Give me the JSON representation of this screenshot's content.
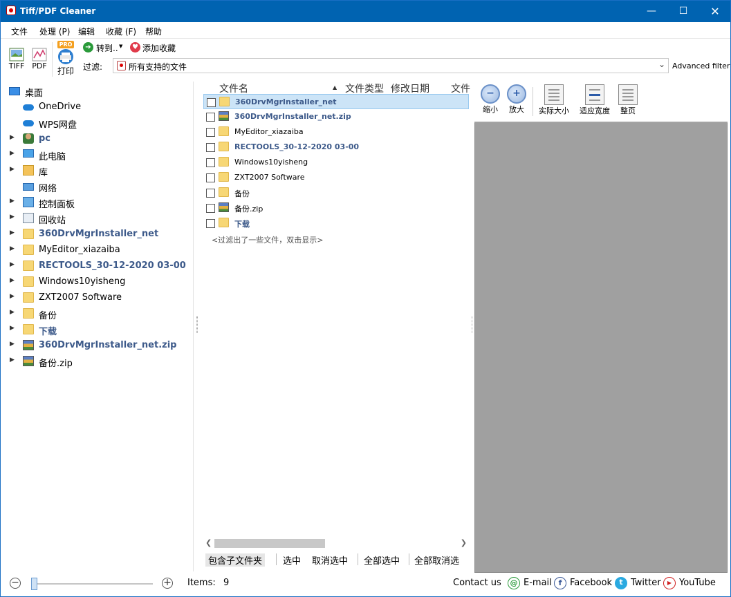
{
  "window": {
    "title": "Tiff/PDF Cleaner"
  },
  "menu": [
    "文件",
    "处理 (P)",
    "编辑",
    "收藏 (F)",
    "帮助"
  ],
  "toolbar": {
    "tiff_label": "TIFF",
    "pdf_label": "PDF",
    "pro_badge": "PRO",
    "print_label": "打印",
    "goto_label": "转到..",
    "add_fav_label": "添加收藏",
    "filter_label": "过滤:",
    "filter_value": "所有支持的文件",
    "advanced_filter": "Advanced filter"
  },
  "tree": [
    {
      "label": "桌面",
      "icon": "desktop-icon",
      "expand": false,
      "highlight": false
    },
    {
      "label": "OneDrive",
      "icon": "cloud-icon",
      "expand": false,
      "highlight": false
    },
    {
      "label": "WPS网盘",
      "icon": "cloud-icon",
      "expand": false,
      "highlight": false
    },
    {
      "label": "pc",
      "icon": "user-icon",
      "expand": true,
      "highlight": true
    },
    {
      "label": "此电脑",
      "icon": "computer-icon",
      "expand": true,
      "highlight": false
    },
    {
      "label": "库",
      "icon": "library-icon",
      "expand": true,
      "highlight": false
    },
    {
      "label": "网络",
      "icon": "network-icon",
      "expand": false,
      "highlight": false
    },
    {
      "label": "控制面板",
      "icon": "control-panel-icon",
      "expand": true,
      "highlight": false
    },
    {
      "label": "回收站",
      "icon": "recycle-bin-icon",
      "expand": true,
      "highlight": false
    },
    {
      "label": "360DrvMgrInstaller_net",
      "icon": "folder-icon",
      "expand": true,
      "highlight": true
    },
    {
      "label": "MyEditor_xiazaiba",
      "icon": "folder-icon",
      "expand": true,
      "highlight": false
    },
    {
      "label": "RECTOOLS_30-12-2020 03-00",
      "icon": "folder-icon",
      "expand": true,
      "highlight": true
    },
    {
      "label": "Windows10yisheng",
      "icon": "folder-icon",
      "expand": true,
      "highlight": false
    },
    {
      "label": "ZXT2007 Software",
      "icon": "folder-icon",
      "expand": true,
      "highlight": false
    },
    {
      "label": "备份",
      "icon": "folder-icon",
      "expand": true,
      "highlight": false
    },
    {
      "label": "下载",
      "icon": "folder-icon",
      "expand": true,
      "highlight": true
    },
    {
      "label": "360DrvMgrInstaller_net.zip",
      "icon": "zip-icon",
      "expand": true,
      "highlight": true
    },
    {
      "label": "备份.zip",
      "icon": "zip-icon",
      "expand": true,
      "highlight": false
    }
  ],
  "file_list": {
    "columns": [
      "文件名",
      "文件类型",
      "修改日期",
      "文件"
    ],
    "rows": [
      {
        "name": "360DrvMgrInstaller_net",
        "icon": "folder-icon",
        "highlight": true,
        "selected": true
      },
      {
        "name": "360DrvMgrInstaller_net.zip",
        "icon": "zip-icon",
        "highlight": true,
        "selected": false
      },
      {
        "name": "MyEditor_xiazaiba",
        "icon": "folder-icon",
        "highlight": false,
        "selected": false
      },
      {
        "name": "RECTOOLS_30-12-2020 03-00",
        "icon": "folder-icon",
        "highlight": true,
        "selected": false
      },
      {
        "name": "Windows10yisheng",
        "icon": "folder-icon",
        "highlight": false,
        "selected": false
      },
      {
        "name": "ZXT2007 Software",
        "icon": "folder-icon",
        "highlight": false,
        "selected": false
      },
      {
        "name": "备份",
        "icon": "folder-icon",
        "highlight": false,
        "selected": false
      },
      {
        "name": "备份.zip",
        "icon": "zip-icon",
        "highlight": false,
        "selected": false
      },
      {
        "name": "下载",
        "icon": "folder-icon",
        "highlight": true,
        "selected": false
      }
    ],
    "hint": "<过滤出了一些文件，双击显示>"
  },
  "list_actions": [
    "包含子文件夹",
    "选中",
    "取消选中",
    "全部选中",
    "全部取消选"
  ],
  "viewer": {
    "zoom_out": "缩小",
    "zoom_in": "放大",
    "actual_size": "实际大小",
    "fit_width": "适应宽度",
    "full_page": "整页"
  },
  "status": {
    "items_label": "Items:",
    "items_count": "9",
    "contact": "Contact us",
    "email": "E-mail",
    "facebook": "Facebook",
    "twitter": "Twitter",
    "youtube": "YouTube"
  },
  "colors": {
    "titlebar": "#0063b1",
    "highlight_text": "#3d5a8a",
    "selection": "#cce4f7",
    "viewer_bg": "#a0a0a0"
  }
}
